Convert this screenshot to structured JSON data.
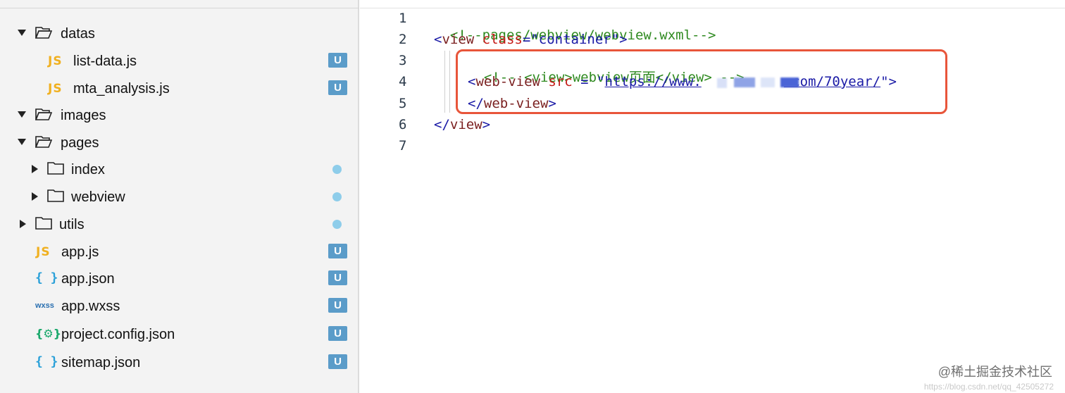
{
  "explorer": {
    "items": [
      {
        "label": "datas",
        "icon": "folder-open-icon",
        "expanded": true
      },
      {
        "label": "list-data.js",
        "icon": "js-file-icon",
        "icon_text": "JS",
        "badge": "U"
      },
      {
        "label": "mta_analysis.js",
        "icon": "js-file-icon",
        "icon_text": "JS",
        "badge": "U"
      },
      {
        "label": "images",
        "icon": "folder-open-icon",
        "expanded": true
      },
      {
        "label": "pages",
        "icon": "folder-open-icon",
        "expanded": true
      },
      {
        "label": "index",
        "icon": "folder-icon",
        "expanded": false,
        "badge": "dot"
      },
      {
        "label": "webview",
        "icon": "folder-icon",
        "expanded": false,
        "badge": "dot"
      },
      {
        "label": "utils",
        "icon": "folder-icon",
        "expanded": false,
        "badge": "dot"
      },
      {
        "label": "app.js",
        "icon": "js-file-icon",
        "icon_text": "JS",
        "badge": "U"
      },
      {
        "label": "app.json",
        "icon": "json-file-icon",
        "icon_text": "{ }",
        "badge": "U"
      },
      {
        "label": "app.wxss",
        "icon": "wxss-file-icon",
        "icon_text": "wxss",
        "badge": "U"
      },
      {
        "label": "project.config.json",
        "icon": "config-json-icon",
        "icon_text": "{⚙}",
        "badge": "U"
      },
      {
        "label": "sitemap.json",
        "icon": "json-file-icon",
        "icon_text": "{ }",
        "badge": "U"
      }
    ]
  },
  "editor": {
    "line_numbers": [
      "1",
      "2",
      "3",
      "4",
      "5",
      "6",
      "7"
    ],
    "lines": {
      "l1_comment": "<!--pages/webview/webview.wxml-->",
      "l2_open": "<",
      "l2_tag": "view",
      "l2_attr": " class",
      "l2_eq": "=",
      "l2_val": "\"container\"",
      "l2_close": ">",
      "l3_comment": "<!-- <view>webview页面</view> -->",
      "l4_open": "<",
      "l4_tag": "web-view",
      "l4_attr": " src",
      "l4_eq": " = ",
      "l4_q1": "\"",
      "l4_url_a": "https://www.",
      "l4_url_b": ".com/70year/",
      "l4_q2": "\"",
      "l4_close": ">",
      "l5_open": "</",
      "l5_tag": "web-view",
      "l5_close": ">",
      "l6_open": "</",
      "l6_tag": "view",
      "l6_close": ">"
    }
  },
  "watermark": {
    "text": "@稀土掘金技术社区",
    "url": "https://blog.csdn.net/qq_42505272"
  },
  "colors": {
    "badge_u": "#5b9cc9",
    "badge_dot": "#8ecdea",
    "highlight": "#e8553a",
    "comment": "#2f8a20"
  }
}
